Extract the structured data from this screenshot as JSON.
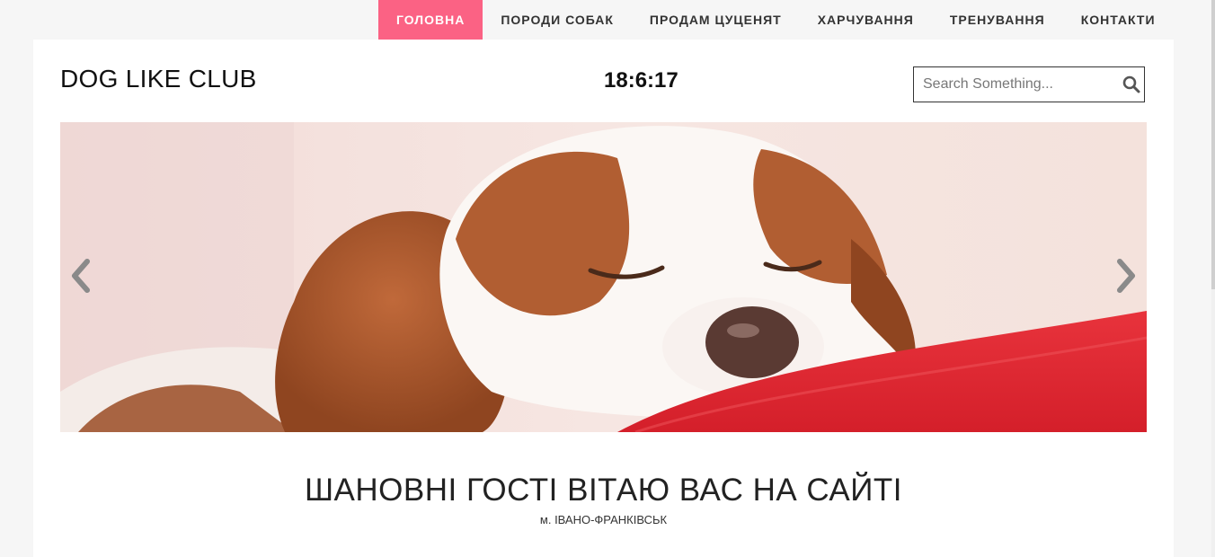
{
  "nav": {
    "items": [
      {
        "label": "ГОЛОВНА",
        "active": true
      },
      {
        "label": "ПОРОДИ СОБАК",
        "active": false
      },
      {
        "label": "ПРОДАМ ЦУЦЕНЯТ",
        "active": false
      },
      {
        "label": "ХАРЧУВАННЯ",
        "active": false
      },
      {
        "label": "ТРЕНУВАННЯ",
        "active": false
      },
      {
        "label": "КОНТАКТИ",
        "active": false
      }
    ]
  },
  "header": {
    "logo": "DOG LIKE CLUB",
    "clock": "18:6:17",
    "search_placeholder": "Search Something..."
  },
  "slider": {
    "prev_icon": "chevron-left-icon",
    "next_icon": "chevron-right-icon"
  },
  "welcome": {
    "title": "ШАНОВНІ ГОСТІ ВІТАЮ ВАС НА САЙТІ",
    "city": "м. ІВАНО-ФРАНКІВСЬК"
  },
  "colors": {
    "accent": "#fb6284",
    "page_bg": "#f6f6f6",
    "pillow": "#e02530"
  }
}
